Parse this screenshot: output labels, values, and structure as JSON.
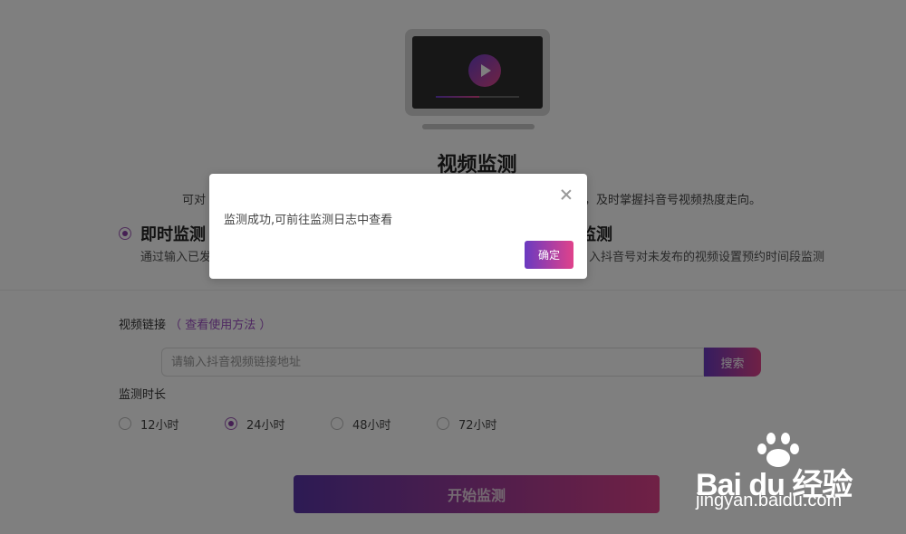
{
  "hero": {
    "title": "视频监测",
    "description_left": "可对",
    "description_right": "，及时掌握抖音号视频热度走向。"
  },
  "modes": [
    {
      "name": "即时监测",
      "description": "通过输入已发",
      "selected": true
    },
    {
      "name": "监测",
      "description": "入抖音号对未发布的视频设置预约时间段监测",
      "selected": false
    }
  ],
  "video_link": {
    "label": "视频链接",
    "help_link": "（ 查看使用方法 ）"
  },
  "search": {
    "placeholder": "请输入抖音视频链接地址",
    "button_label": "搜索"
  },
  "duration": {
    "label": "监测时长",
    "options": [
      {
        "label": "12小时",
        "selected": false
      },
      {
        "label": "24小时",
        "selected": true
      },
      {
        "label": "48小时",
        "selected": false
      },
      {
        "label": "72小时",
        "selected": false
      }
    ]
  },
  "start_button": "开始监测",
  "dialog": {
    "message": "监测成功,可前往监测日志中查看",
    "confirm_label": "确定"
  },
  "watermark": {
    "brand": "Bai du 经验",
    "url": "jingyan.baidu.com"
  },
  "icons": {
    "hero": "video-monitor-icon",
    "close": "close-icon"
  },
  "colors": {
    "accent_start": "#6a3ac0",
    "accent_end": "#e0428b"
  }
}
